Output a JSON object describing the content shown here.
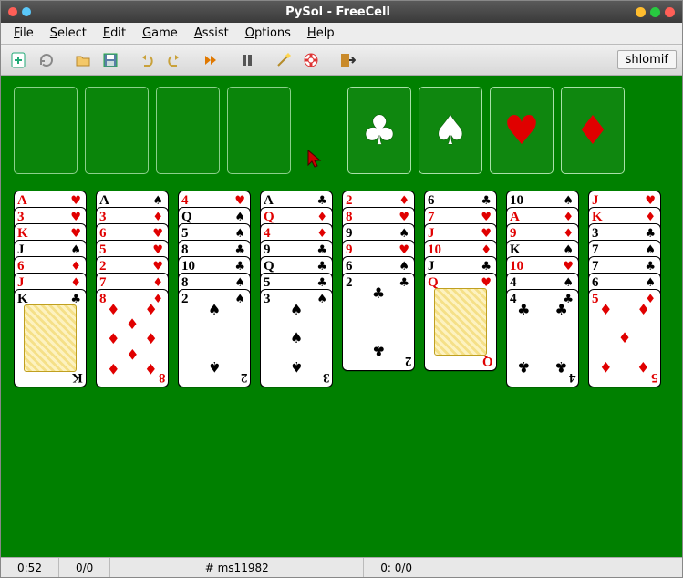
{
  "window": {
    "title": "PySol - FreeCell"
  },
  "menu": {
    "file": "File",
    "select": "Select",
    "edit": "Edit",
    "game": "Game",
    "assist": "Assist",
    "options": "Options",
    "help": "Help"
  },
  "toolbar": {
    "user": "shlomif"
  },
  "foundations": [
    "club",
    "spade",
    "heart",
    "diamond"
  ],
  "status": {
    "time": "0:52",
    "moves": "0/0",
    "game_id": "# ms11982",
    "redeals": "0: 0/0"
  },
  "suits": {
    "club": "♣",
    "spade": "♠",
    "heart": "♥",
    "diamond": "♦"
  },
  "colors": {
    "club": "black",
    "spade": "black",
    "heart": "red",
    "diamond": "red"
  },
  "columns": [
    [
      {
        "r": "A",
        "s": "heart"
      },
      {
        "r": "3",
        "s": "heart"
      },
      {
        "r": "K",
        "s": "heart"
      },
      {
        "r": "J",
        "s": "spade"
      },
      {
        "r": "6",
        "s": "diamond"
      },
      {
        "r": "J",
        "s": "diamond"
      },
      {
        "r": "K",
        "s": "club"
      }
    ],
    [
      {
        "r": "A",
        "s": "spade"
      },
      {
        "r": "3",
        "s": "diamond"
      },
      {
        "r": "6",
        "s": "heart"
      },
      {
        "r": "5",
        "s": "heart"
      },
      {
        "r": "2",
        "s": "heart"
      },
      {
        "r": "7",
        "s": "diamond"
      },
      {
        "r": "8",
        "s": "diamond"
      }
    ],
    [
      {
        "r": "4",
        "s": "heart"
      },
      {
        "r": "Q",
        "s": "spade"
      },
      {
        "r": "5",
        "s": "spade"
      },
      {
        "r": "8",
        "s": "club"
      },
      {
        "r": "10",
        "s": "club"
      },
      {
        "r": "8",
        "s": "spade"
      },
      {
        "r": "2",
        "s": "spade"
      }
    ],
    [
      {
        "r": "A",
        "s": "club"
      },
      {
        "r": "Q",
        "s": "diamond"
      },
      {
        "r": "4",
        "s": "diamond"
      },
      {
        "r": "9",
        "s": "club"
      },
      {
        "r": "Q",
        "s": "club"
      },
      {
        "r": "5",
        "s": "club"
      },
      {
        "r": "3",
        "s": "spade"
      }
    ],
    [
      {
        "r": "2",
        "s": "diamond"
      },
      {
        "r": "8",
        "s": "heart"
      },
      {
        "r": "9",
        "s": "spade"
      },
      {
        "r": "9",
        "s": "heart"
      },
      {
        "r": "6",
        "s": "spade"
      },
      {
        "r": "2",
        "s": "club"
      }
    ],
    [
      {
        "r": "6",
        "s": "club"
      },
      {
        "r": "7",
        "s": "heart"
      },
      {
        "r": "J",
        "s": "heart"
      },
      {
        "r": "10",
        "s": "diamond"
      },
      {
        "r": "J",
        "s": "club"
      },
      {
        "r": "Q",
        "s": "heart"
      }
    ],
    [
      {
        "r": "10",
        "s": "spade"
      },
      {
        "r": "A",
        "s": "diamond"
      },
      {
        "r": "9",
        "s": "diamond"
      },
      {
        "r": "K",
        "s": "spade"
      },
      {
        "r": "10",
        "s": "heart"
      },
      {
        "r": "4",
        "s": "spade"
      },
      {
        "r": "4",
        "s": "club"
      }
    ],
    [
      {
        "r": "J",
        "s": "heart"
      },
      {
        "r": "K",
        "s": "diamond"
      },
      {
        "r": "3",
        "s": "club"
      },
      {
        "r": "7",
        "s": "spade"
      },
      {
        "r": "7",
        "s": "club"
      },
      {
        "r": "6",
        "s": "spade"
      },
      {
        "r": "5",
        "s": "diamond"
      }
    ]
  ]
}
